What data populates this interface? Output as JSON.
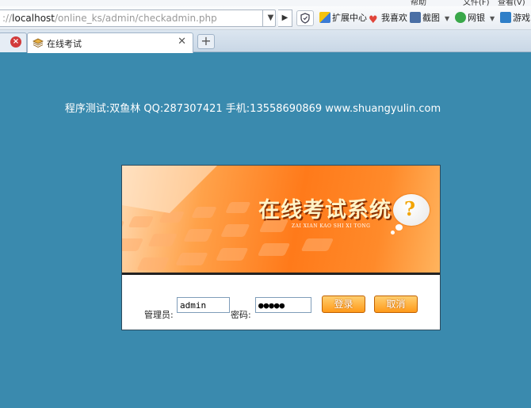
{
  "browser": {
    "menu_fragments": [
      "帮助",
      "文件(F)",
      "查看(V)"
    ],
    "url_host": "localhost",
    "url_path": "/online_ks/admin/checkadmin.php",
    "url_prefix": "://",
    "toolbar_items": [
      {
        "label": "扩展中心",
        "icon": "extensions-icon",
        "color": "#3a7bd5"
      },
      {
        "label": "我喜欢",
        "icon": "heart-icon",
        "color": "#e0453a"
      },
      {
        "label": "截图",
        "icon": "screenshot-icon",
        "color": "#4a6fa5"
      },
      {
        "label": "网银",
        "icon": "bank-icon",
        "color": "#3aa84a"
      },
      {
        "label": "游戏",
        "icon": "game-icon",
        "color": "#2f7fc8"
      }
    ],
    "tabs": [
      {
        "label": "在线考试",
        "active": true
      }
    ],
    "new_tab_label": "+"
  },
  "page": {
    "dev_info": "程序测试:双鱼林 QQ:287307421 手机:13558690869 www.shuangyulin.com",
    "banner": {
      "title": "在线考试系统",
      "pinyin": "ZAI XIAN KAO SHI XI TONG",
      "qmark": "?"
    },
    "login": {
      "username_label": "管理员:",
      "username_value": "admin",
      "password_label": "密码:",
      "password_value": "●●●●●",
      "login_button": "登录",
      "cancel_button": "取消"
    }
  },
  "colors": {
    "page_background": "#3a8aae",
    "button_orange": "#ff9a1a"
  }
}
